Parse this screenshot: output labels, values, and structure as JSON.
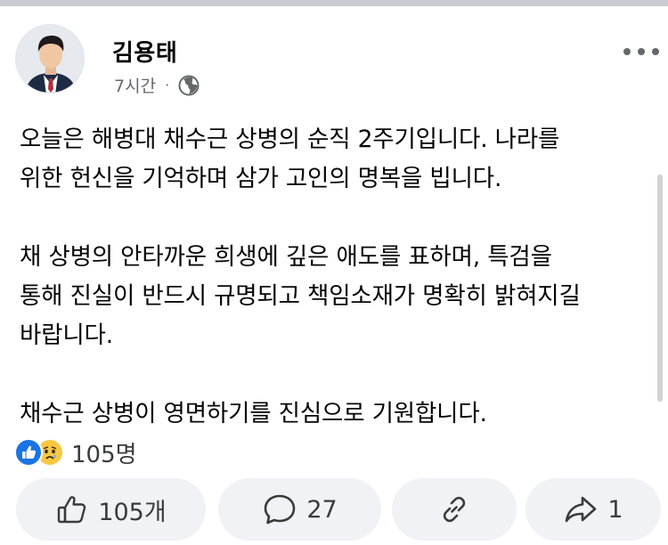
{
  "post": {
    "author": "김용태",
    "time": "7시간",
    "dot": "·",
    "privacy_icon": "globe-icon",
    "lines": [
      "오늘은 해병대 채수근 상병의 순직 2주기입니다. 나라를",
      "위한 헌신을 기억하며 삼가 고인의 명복을 빕니다.",
      "",
      "채 상병의 안타까운 희생에 깊은 애도를 표하며, 특검을",
      "통해 진실이 반드시 규명되고 책임소재가 명확히 밝혀지길",
      "바랍니다.",
      "",
      "채수근 상병이 영면하기를 진심으로 기원합니다."
    ]
  },
  "reactions": {
    "icons": [
      "like-reaction-icon",
      "sad-reaction-icon"
    ],
    "count": "105명"
  },
  "actions": {
    "like_count": "105개",
    "comment_count": "27",
    "share_count": "1"
  },
  "colors": {
    "accent": "#1b74e4",
    "sad": "#f7c844",
    "button_bg": "#f0f2f5",
    "secondary_text": "#65676b"
  }
}
